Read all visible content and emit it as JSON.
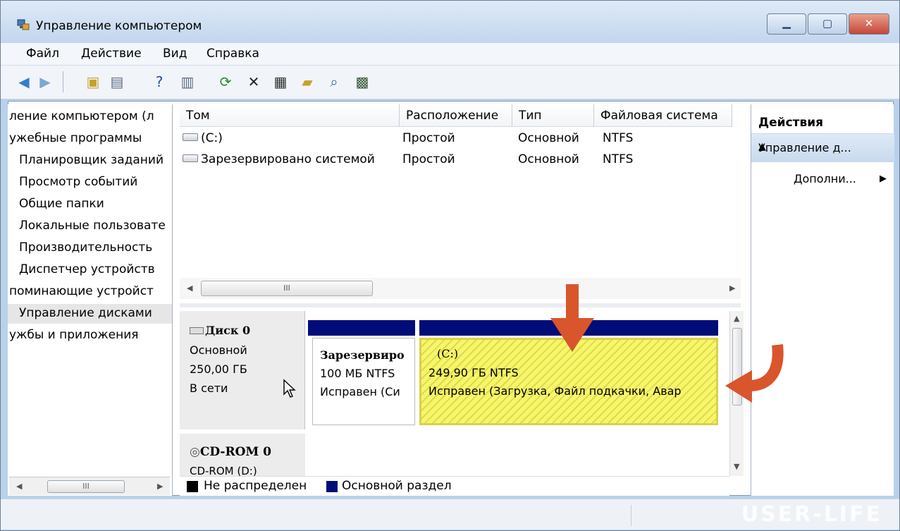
{
  "window": {
    "title": "Управление компьютером"
  },
  "menu": [
    "Файл",
    "Действие",
    "Вид",
    "Справка"
  ],
  "tree": {
    "items": [
      "ление компьютером (л",
      "ужебные программы",
      "Планировщик заданий",
      "Просмотр событий",
      "Общие папки",
      "Локальные пользовате",
      "Производительность",
      "Диспетчер устройств",
      "поминающие устройст",
      "Управление дисками",
      "ужбы и приложения"
    ],
    "selected_index": 9
  },
  "volumes": {
    "columns": [
      "Том",
      "Расположение",
      "Тип",
      "Файловая система"
    ],
    "rows": [
      [
        "(C:)",
        "Простой",
        "Основной",
        "NTFS"
      ],
      [
        "Зарезервировано системой",
        "Простой",
        "Основной",
        "NTFS"
      ]
    ],
    "scroll_thumb_label": "III"
  },
  "disk0": {
    "name": "Диск 0",
    "type": "Основной",
    "size": "250,00 ГБ",
    "status": "В сети",
    "partitions": [
      {
        "name": "Зарезервиро",
        "size": "100 МБ NTFS",
        "status": "Исправен (Си"
      },
      {
        "name": "(C:)",
        "size": "249,90 ГБ NTFS",
        "status": "Исправен (Загрузка, Файл подкачки, Авар"
      }
    ]
  },
  "cdrom": {
    "name": "CD-ROM 0",
    "sub": "CD-ROM (D:)"
  },
  "legend": [
    {
      "label": "Не распределен",
      "color": "#000000"
    },
    {
      "label": "Основной раздел",
      "color": "#000c78"
    }
  ],
  "actions": {
    "header": "Действия",
    "group": "Управление д...",
    "more": "Дополни..."
  },
  "tree_scroll_thumb_label": "III",
  "watermark": "USER-LIFE",
  "colors": {
    "accent_orange": "#d9552c",
    "partition_bar": "#000c78",
    "selection_yellow": "#f6f66b"
  }
}
